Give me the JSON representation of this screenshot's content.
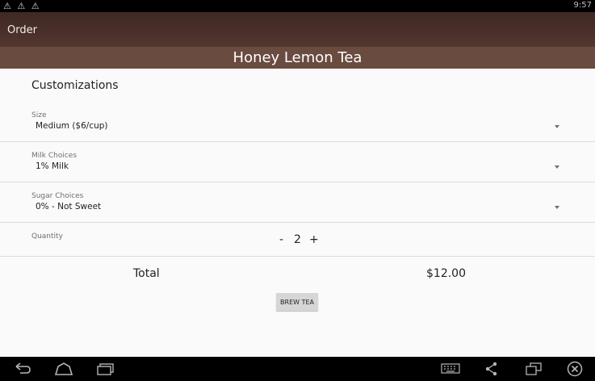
{
  "status_bar": {
    "notification_icons": "⚠ ⚠ ⚠",
    "time": "9:57"
  },
  "action_bar": {
    "title": "Order"
  },
  "product": {
    "name": "Honey Lemon Tea"
  },
  "customizations": {
    "title": "Customizations",
    "size": {
      "label": "Size",
      "value": "Medium ($6/cup)"
    },
    "milk": {
      "label": "Milk Choices",
      "value": "1% Milk"
    },
    "sugar": {
      "label": "Sugar Choices",
      "value": "0% - Not Sweet"
    },
    "quantity": {
      "label": "Quantity",
      "minus": "-",
      "value": "2",
      "plus": "+"
    }
  },
  "total": {
    "label": "Total",
    "value": "$12.00"
  },
  "actions": {
    "brew_label": "BREW TEA"
  },
  "nav_bar": {
    "icons": [
      "back-icon",
      "home-icon",
      "recent-apps-icon",
      "keyboard-icon",
      "share-icon",
      "window-icon",
      "close-icon"
    ]
  },
  "colors": {
    "action_bar": "#4a3029",
    "banner": "#6a4b3f",
    "status_bar": "#000000"
  }
}
